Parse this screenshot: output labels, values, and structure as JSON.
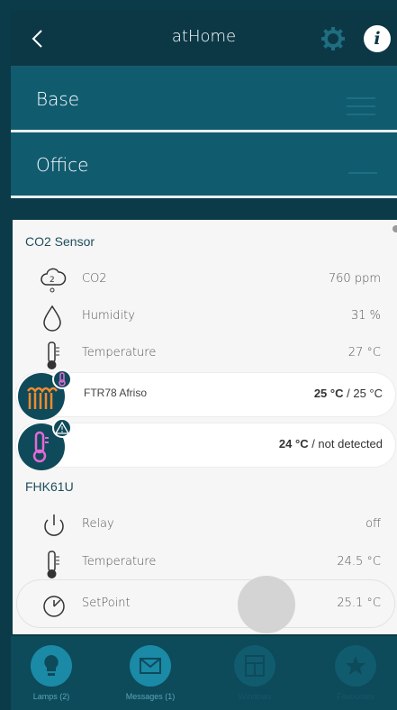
{
  "header": {
    "title": "atHome",
    "back_icon": "chevron-left-icon",
    "settings_icon": "gear-icon",
    "info_icon": "info-icon",
    "info_glyph": "i"
  },
  "sections": [
    {
      "label": "Base"
    },
    {
      "label": "Office"
    }
  ],
  "co2_sensor": {
    "title": "CO2 Sensor",
    "rows": [
      {
        "label": "CO2",
        "value": "760 ppm"
      },
      {
        "label": "Humidity",
        "value": "31 %"
      },
      {
        "label": "Temperature",
        "value": "27 °C"
      }
    ]
  },
  "ftr": {
    "label": "FTR78 Afriso",
    "value_bold": "25 °C",
    "value_rest": " / 25 °C"
  },
  "thermo": {
    "value_bold": "24 °C",
    "value_rest": " / not detected"
  },
  "fhk": {
    "title": "FHK61U",
    "rows": [
      {
        "label": "Relay",
        "value": "off"
      },
      {
        "label": "Temperature",
        "value": "24.5 °C"
      },
      {
        "label": "SetPoint",
        "value": "25.1 °C"
      }
    ]
  },
  "tabs": [
    {
      "label": "Lamps (2)",
      "icon": "bulb-icon"
    },
    {
      "label": "Messages (1)",
      "icon": "envelope-icon"
    },
    {
      "label": "Windows",
      "icon": "window-icon"
    },
    {
      "label": "Favourites",
      "icon": "star-icon"
    }
  ],
  "colors": {
    "primary": "#0c3846",
    "section": "#115b6f",
    "accent": "#0f4a5a",
    "active_tab": "#1a8aa6"
  }
}
